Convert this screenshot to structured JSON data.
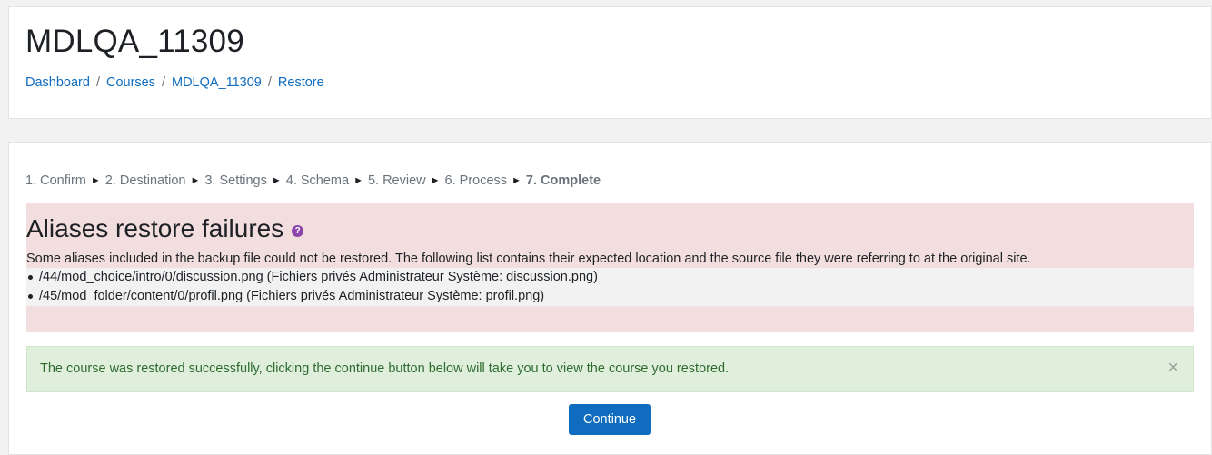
{
  "header": {
    "title": "MDLQA_11309",
    "breadcrumb": [
      {
        "label": "Dashboard"
      },
      {
        "label": "Courses"
      },
      {
        "label": "MDLQA_11309"
      },
      {
        "label": "Restore"
      }
    ],
    "separator": "/"
  },
  "steps": {
    "items": [
      "1. Confirm",
      "2. Destination",
      "3. Settings",
      "4. Schema",
      "5. Review",
      "6. Process",
      "7. Complete"
    ],
    "current_index": 6,
    "arrow": "►"
  },
  "aliases": {
    "title": "Aliases restore failures",
    "help_icon": "?",
    "description": "Some aliases included in the backup file could not be restored. The following list contains their expected location and the source file they were referring to at the original site.",
    "items": [
      "/44/mod_choice/intro/0/discussion.png (Fichiers privés Administrateur Système: discussion.png)",
      "/45/mod_folder/content/0/profil.png (Fichiers privés Administrateur Système: profil.png)"
    ]
  },
  "alert": {
    "message": "The course was restored successfully, clicking the continue button below will take you to view the course you restored.",
    "close": "×"
  },
  "continue_label": "Continue"
}
